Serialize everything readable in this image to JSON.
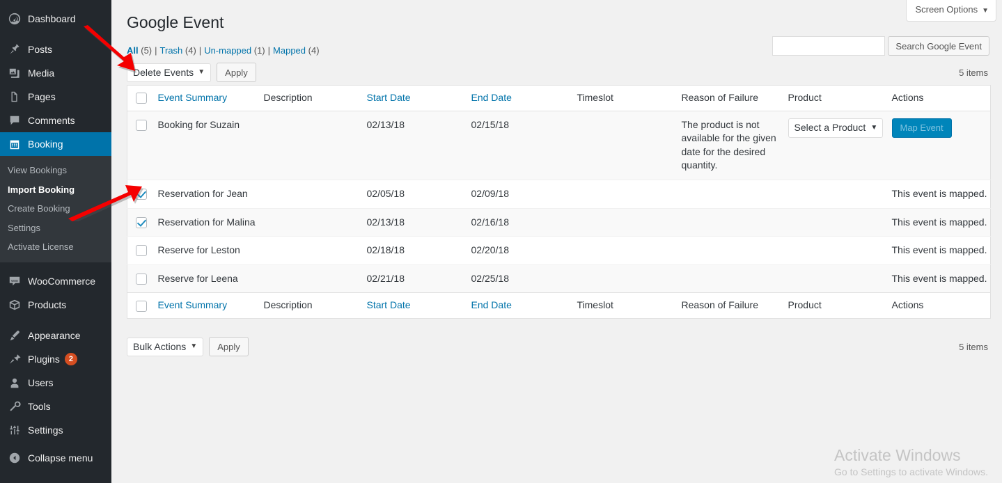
{
  "sidebar": {
    "items": [
      {
        "label": "Dashboard",
        "icon": "dashboard-icon",
        "name": "sidebar-item-dashboard"
      },
      {
        "label": "Posts",
        "icon": "pin-icon",
        "name": "sidebar-item-posts"
      },
      {
        "label": "Media",
        "icon": "media-icon",
        "name": "sidebar-item-media"
      },
      {
        "label": "Pages",
        "icon": "pages-icon",
        "name": "sidebar-item-pages"
      },
      {
        "label": "Comments",
        "icon": "comment-icon",
        "name": "sidebar-item-comments"
      },
      {
        "label": "Booking",
        "icon": "calendar-icon",
        "name": "sidebar-item-booking",
        "current": true
      }
    ],
    "submenu": [
      {
        "label": "View Bookings",
        "name": "submenu-item-view-bookings"
      },
      {
        "label": "Import Booking",
        "name": "submenu-item-import-booking",
        "current": true
      },
      {
        "label": "Create Booking",
        "name": "submenu-item-create-booking"
      },
      {
        "label": "Settings",
        "name": "submenu-item-settings"
      },
      {
        "label": "Activate License",
        "name": "submenu-item-activate-license"
      }
    ],
    "items2": [
      {
        "label": "WooCommerce",
        "icon": "woo-icon",
        "name": "sidebar-item-woocommerce"
      },
      {
        "label": "Products",
        "icon": "box-icon",
        "name": "sidebar-item-products"
      }
    ],
    "items3": [
      {
        "label": "Appearance",
        "icon": "brush-icon",
        "name": "sidebar-item-appearance"
      },
      {
        "label": "Plugins",
        "icon": "plug-icon",
        "name": "sidebar-item-plugins",
        "badge": "2"
      },
      {
        "label": "Users",
        "icon": "user-icon",
        "name": "sidebar-item-users"
      },
      {
        "label": "Tools",
        "icon": "wrench-icon",
        "name": "sidebar-item-tools"
      },
      {
        "label": "Settings",
        "icon": "sliders-icon",
        "name": "sidebar-item-settings"
      }
    ],
    "collapse": {
      "label": "Collapse menu",
      "icon": "collapse-icon"
    }
  },
  "header": {
    "screen_options": "Screen Options",
    "screen_options_caret": "▼",
    "page_title": "Google Event"
  },
  "filters": [
    {
      "label": "All",
      "count": "(5)",
      "current": true
    },
    {
      "label": "Trash",
      "count": "(4)"
    },
    {
      "label": "Un-mapped",
      "count": "(1)"
    },
    {
      "label": "Mapped",
      "count": "(4)"
    }
  ],
  "search": {
    "value": "",
    "placeholder": "",
    "button_label": "Search Google Event"
  },
  "tablenav": {
    "top_select_label": "Delete Events",
    "bottom_select_label": "Bulk Actions",
    "apply_label": "Apply",
    "caret": "▼",
    "items_top": "5 items",
    "items_bottom": "5 items"
  },
  "table": {
    "columns": [
      {
        "label": "Event Summary",
        "sortable": true,
        "name": "column-event-summary"
      },
      {
        "label": "Description",
        "sortable": false,
        "name": "column-description"
      },
      {
        "label": "Start Date",
        "sortable": true,
        "name": "column-start-date"
      },
      {
        "label": "End Date",
        "sortable": true,
        "name": "column-end-date"
      },
      {
        "label": "Timeslot",
        "sortable": false,
        "name": "column-timeslot"
      },
      {
        "label": "Reason of Failure",
        "sortable": false,
        "name": "column-reason-of-failure"
      },
      {
        "label": "Product",
        "sortable": false,
        "name": "column-product"
      },
      {
        "label": "Actions",
        "sortable": false,
        "name": "column-actions"
      }
    ],
    "rows": [
      {
        "checked": false,
        "summary": "Booking for Suzain",
        "description": "",
        "start_date": "02/13/18",
        "end_date": "02/15/18",
        "timeslot": "",
        "reason": "The product is not available for the given date for the desired quantity.",
        "product_select": "Select a Product",
        "action_button": "Map Event",
        "action_text": "",
        "stripe": "alt"
      },
      {
        "checked": true,
        "summary": "Reservation for Jean",
        "description": "",
        "start_date": "02/05/18",
        "end_date": "02/09/18",
        "timeslot": "",
        "reason": "",
        "product_select": "",
        "action_button": "",
        "action_text": "This event is mapped.",
        "stripe": "white"
      },
      {
        "checked": true,
        "summary": "Reservation for Malina",
        "description": "",
        "start_date": "02/13/18",
        "end_date": "02/16/18",
        "timeslot": "",
        "reason": "",
        "product_select": "",
        "action_button": "",
        "action_text": "This event is mapped.",
        "stripe": "alt"
      },
      {
        "checked": false,
        "summary": "Reserve for Leston",
        "description": "",
        "start_date": "02/18/18",
        "end_date": "02/20/18",
        "timeslot": "",
        "reason": "",
        "product_select": "",
        "action_button": "",
        "action_text": "This event is mapped.",
        "stripe": "white"
      },
      {
        "checked": false,
        "summary": "Reserve for Leena",
        "description": "",
        "start_date": "02/21/18",
        "end_date": "02/25/18",
        "timeslot": "",
        "reason": "",
        "product_select": "",
        "action_button": "",
        "action_text": "This event is mapped.",
        "stripe": "alt"
      }
    ]
  },
  "watermark": {
    "title": "Activate Windows",
    "subtitle": "Go to Settings to activate Windows."
  },
  "colors": {
    "sidebar_bg": "#23282d",
    "sidebar_submenu_bg": "#32373c",
    "accent_blue": "#0073aa",
    "button_blue": "#0085ba",
    "link_blue": "#0073aa",
    "badge_orange": "#d54e21",
    "arrow_red": "#f50000",
    "page_bg": "#f1f1f1",
    "row_alt": "#f9f9f9"
  }
}
